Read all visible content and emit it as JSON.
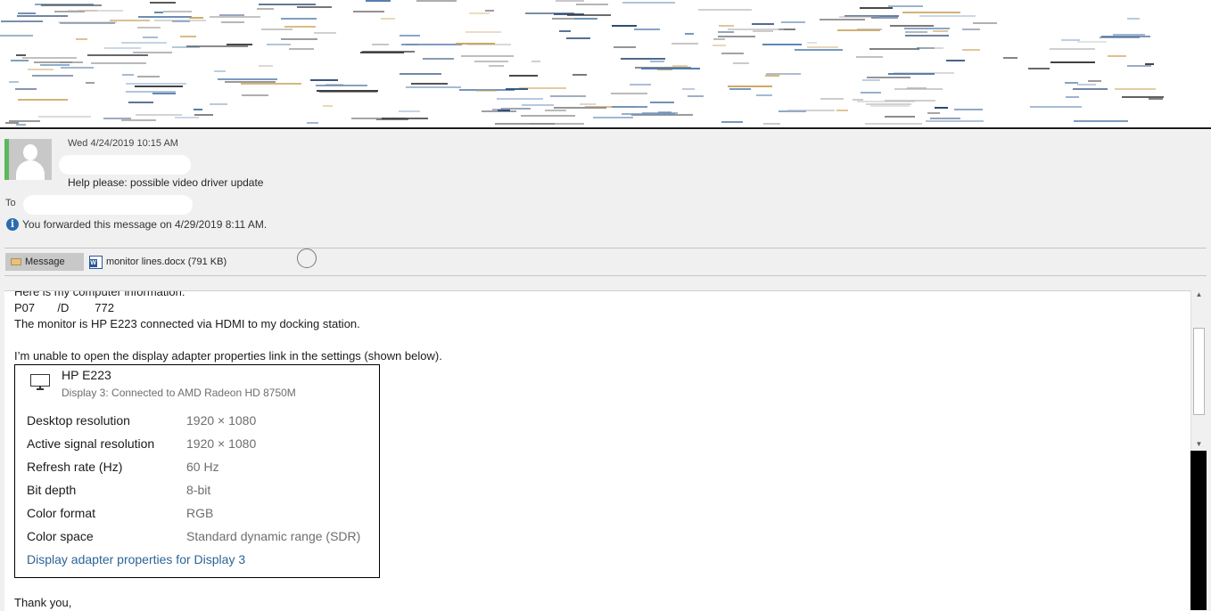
{
  "header": {
    "date": "Wed 4/24/2019 10:15 AM",
    "subject": "Help please: possible video driver update",
    "to_label": "To",
    "forward_info": "You forwarded this message on 4/29/2019 8:11 AM."
  },
  "tabs": {
    "message_label": "Message",
    "attachment_label": "monitor lines.docx (791 KB)"
  },
  "body": {
    "lines": [
      "Here is my computer information:",
      "P07       /D        772",
      "The monitor is HP E223 connected via HDMI to my docking station.",
      "I’m unable to open the display adapter properties link in the settings (shown below).",
      "Thank you,"
    ]
  },
  "settings": {
    "monitor_name": "HP E223",
    "monitor_sub": "Display 3: Connected to AMD Radeon HD 8750M",
    "rows": [
      {
        "label": "Desktop resolution",
        "value": "1920 × 1080"
      },
      {
        "label": "Active signal resolution",
        "value": "1920 × 1080"
      },
      {
        "label": "Refresh rate (Hz)",
        "value": "60 Hz"
      },
      {
        "label": "Bit depth",
        "value": "8-bit"
      },
      {
        "label": "Color format",
        "value": "RGB"
      },
      {
        "label": "Color space",
        "value": "Standard dynamic range (SDR)"
      }
    ],
    "link": "Display adapter properties for Display 3"
  },
  "colors": {
    "presence": "#5cb85c",
    "link": "#2b6496",
    "info_icon": "#2b6cb0",
    "word_blue": "#2b579a"
  },
  "icons": [
    "user-avatar-icon",
    "info-icon",
    "envelope-icon",
    "word-doc-icon",
    "monitor-icon",
    "scroll-up-icon",
    "scroll-down-icon"
  ]
}
